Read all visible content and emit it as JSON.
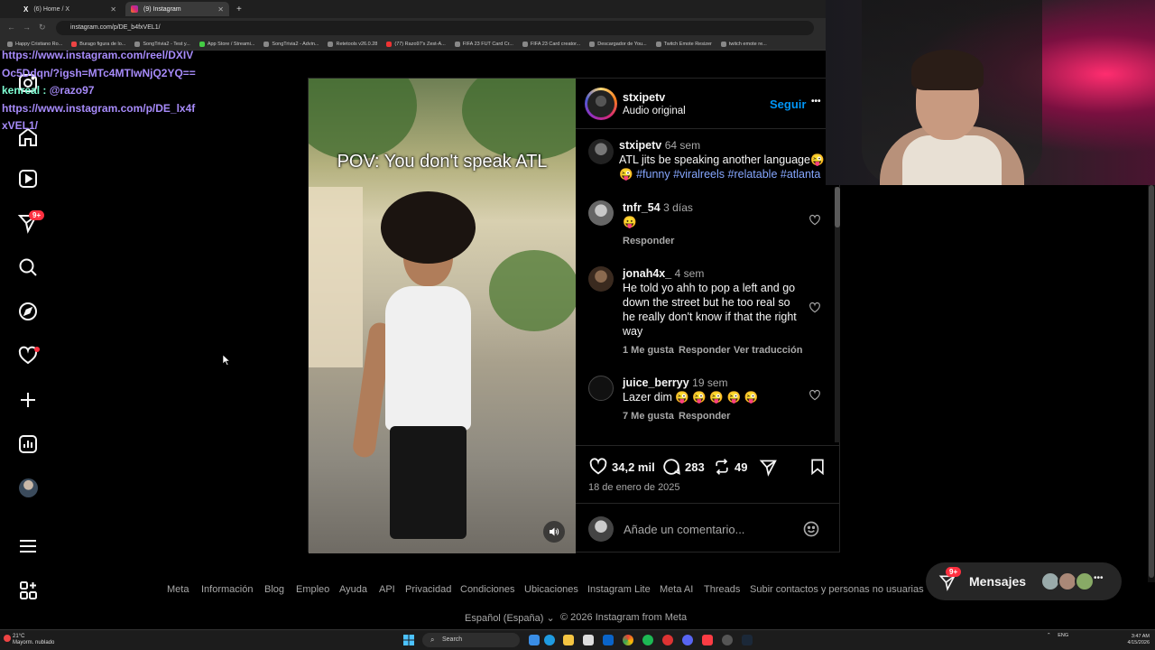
{
  "browser": {
    "tabs": [
      {
        "title": "(6) Home / X",
        "active": false
      },
      {
        "title": "(9) Instagram",
        "active": true
      }
    ],
    "new_tab": "+",
    "url": "instagram.com/p/DE_b4fxVEL1/",
    "bookmarks": [
      "Happy Cristiano Ro...",
      "Burago figura de lo...",
      "SongTrivia2 - Test y...",
      "App Store / Streami...",
      "SongTrivia2 - Advin...",
      "Retetools v26.0.28",
      "(77) Razo97's Zest-A...",
      "FIFA 23 FUT Card Cr...",
      "FIFA 23 Card creator...",
      "Descargador de You...",
      "Twitch Emote Resizer",
      "twitch emote re..."
    ]
  },
  "chat": {
    "line1": "https://www.instagram.com/reel/DXIVOc5Ddqn/?igsh=MTc4MTIwNjQ2YQ==",
    "user": "kenreal :",
    "mention": "@razo97",
    "line2": "https://www.instagram.com/p/DE_lx4fxVEL1/"
  },
  "nav": {
    "notif_badge": "9+",
    "icons": [
      "instagram-logo-icon",
      "home-icon",
      "reels-icon",
      "messages-icon",
      "search-icon",
      "explore-icon",
      "notifications-icon",
      "create-icon",
      "dashboard-icon",
      "profile-avatar",
      "menu-icon",
      "meta-apps-icon"
    ]
  },
  "post": {
    "overlay_text": "POV: You don't speak ATL",
    "author": "stxipetv",
    "audio": "Audio original",
    "follow": "Seguir",
    "more": "•••",
    "caption": {
      "user": "stxipetv",
      "time": "64 sem",
      "text": "ATL jits be speaking another language😜",
      "emoji": "😜",
      "hashtags": "#funny #viralreels #relatable #atlanta"
    },
    "comments": [
      {
        "user": "tnfr_54",
        "time": "3 días",
        "text": "😛",
        "likes": "",
        "reply": "Responder",
        "translate": ""
      },
      {
        "user": "jonah4x_",
        "time": "4 sem",
        "text": "He told yo ahh to pop a left and go down the street but he too real so he really don't know if that the right way",
        "likes": "1 Me gusta",
        "reply": "Responder",
        "translate": "Ver traducción"
      },
      {
        "user": "juice_berryy",
        "time": "19 sem",
        "text": "Lazer dim 😜 😜 😜 😜 😜",
        "likes": "7 Me gusta",
        "reply": "Responder",
        "translate": ""
      }
    ],
    "like_count": "34,2 mil",
    "comment_count": "283",
    "repost_count": "49",
    "date": "18 de enero de 2025",
    "add_comment_placeholder": "Añade un comentario..."
  },
  "messages": {
    "label": "Mensajes",
    "badge": "9+"
  },
  "footer": {
    "links": [
      "Meta",
      "Información",
      "Blog",
      "Empleo",
      "Ayuda",
      "API",
      "Privacidad",
      "Condiciones",
      "Ubicaciones",
      "Instagram Lite",
      "Meta AI",
      "Threads",
      "Subir contactos y personas no usuarias"
    ],
    "language": "Español (España)",
    "copyright": "© 2026 Instagram from Meta"
  },
  "taskbar": {
    "temp": "21°C",
    "weather": "Mayorm. nublado",
    "search": "Search",
    "lang": "ENG",
    "time": "3:47 AM",
    "date": "4/15/2026"
  },
  "colors": {
    "accent": "#0095f6",
    "badge": "#ff3040",
    "hashtag": "#86a7ff",
    "chat_link": "#a78bfa",
    "chat_user": "#7fffd4"
  }
}
